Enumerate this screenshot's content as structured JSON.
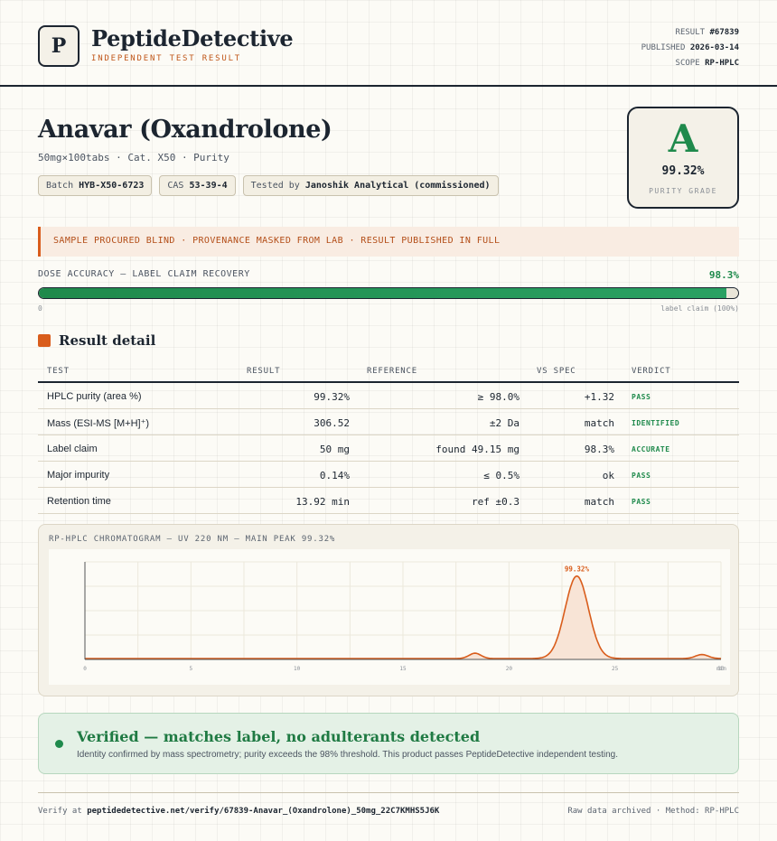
{
  "header": {
    "logo_letter": "P",
    "brand": "PeptideDetective",
    "tagline": "INDEPENDENT TEST RESULT",
    "result_label": "RESULT",
    "result_value": "#67839",
    "published_label": "PUBLISHED",
    "published_value": "2026-03-14",
    "scope_label": "SCOPE",
    "scope_value": "RP-HPLC"
  },
  "product": {
    "title": "Anavar (Oxandrolone)",
    "subtitle": "50mg×100tabs · Cat. X50 · Purity",
    "batch_label": "Batch",
    "batch_value": "HYB-X50-6723",
    "cas_label": "CAS",
    "cas_value": "53-39-4",
    "tested_label": "Tested by",
    "tested_value": "Janoshik Analytical (commissioned)"
  },
  "grade": {
    "letter": "A",
    "purity": "99.32%",
    "label": "PURITY GRADE"
  },
  "notice": "SAMPLE PROCURED BLIND · PROVENANCE MASKED FROM LAB · RESULT PUBLISHED IN FULL",
  "dose": {
    "label": "DOSE ACCURACY — LABEL CLAIM RECOVERY",
    "value_text": "98.3%",
    "fraction": 0.983,
    "min_label": "0",
    "max_label": "label claim (100%)"
  },
  "section_title": "Result detail",
  "table": {
    "headers": [
      "TEST",
      "RESULT",
      "REFERENCE",
      "VS SPEC",
      "VERDICT"
    ],
    "rows": [
      {
        "test": "HPLC purity (area %)",
        "result": "99.32%",
        "reference": "≥ 98.0%",
        "vs": "+1.32",
        "verdict": "PASS"
      },
      {
        "test": "Mass (ESI-MS [M+H]⁺)",
        "result": "306.52",
        "reference": "±2 Da",
        "vs": "match",
        "verdict": "IDENTIFIED"
      },
      {
        "test": "Label claim",
        "result": "50 mg",
        "reference": "found 49.15 mg",
        "vs": "98.3%",
        "verdict": "ACCURATE"
      },
      {
        "test": "Major impurity",
        "result": "0.14%",
        "reference": "≤ 0.5%",
        "vs": "ok",
        "verdict": "PASS"
      },
      {
        "test": "Retention time",
        "result": "13.92 min",
        "reference": "ref ±0.3",
        "vs": "match",
        "verdict": "PASS"
      }
    ]
  },
  "chromatogram": {
    "title": "RP-HPLC CHROMATOGRAM — UV 220 NM — MAIN PEAK 99.32%",
    "colors": {
      "line": "#d95d1c",
      "fill": "#f8e4d6"
    }
  },
  "chart_data": {
    "type": "line",
    "title": "RP-HPLC CHROMATOGRAM — UV 220 NM — MAIN PEAK 99.32%",
    "xlabel": "",
    "ylabel": "",
    "x_unit": "min",
    "xlim": [
      0,
      30
    ],
    "ylim": [
      0,
      1.1
    ],
    "x_ticks": [
      0,
      5,
      10,
      15,
      20,
      25,
      30
    ],
    "x_tick_labels": [
      "0",
      "5",
      "10",
      "15",
      "20",
      "25",
      "30"
    ],
    "peaks": [
      {
        "x": 18.4,
        "height": 0.06,
        "width": 0.28
      },
      {
        "x": 23.2,
        "height": 0.93,
        "width": 0.55,
        "label": "99.32%"
      },
      {
        "x": 29.1,
        "height": 0.045,
        "width": 0.3
      }
    ],
    "baseline": 0.01,
    "grid": true
  },
  "verified": {
    "title": "Verified — matches label, no adulterants detected",
    "text": "Identity confirmed by mass spectrometry; purity exceeds the 98% threshold. This product passes PeptideDetective independent testing."
  },
  "footer": {
    "verify_label": "Verify at",
    "verify_url": "peptidedetective.net/verify/67839-Anavar_(Oxandrolone)_50mg_22C7KMHS5J6K",
    "right_text": "Raw data archived · Method: RP-HPLC"
  }
}
